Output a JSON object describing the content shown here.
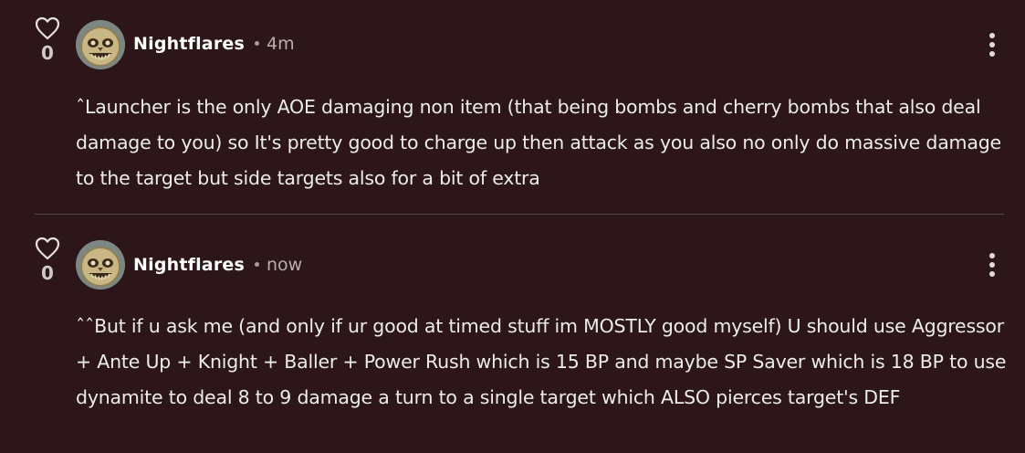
{
  "comments": [
    {
      "likes": "0",
      "author": "Nightflares",
      "time": "4m",
      "avatar_icon": "skull-moon-avatar-icon",
      "text": "ˆLauncher is the only AOE damaging non item (that being bombs and cherry bombs that also deal damage to you) so It's pretty good to charge up then attack as you also no only do massive damage to the target but side targets also for a bit of extra"
    },
    {
      "likes": "0",
      "author": "Nightflares",
      "time": "now",
      "avatar_icon": "skull-moon-avatar-icon",
      "text": "ˆˆBut if u ask me (and only if ur good at timed stuff im MOSTLY good myself) U should use Aggressor + Ante Up + Knight + Baller + Power Rush which is 15 BP and maybe SP Saver which is 18 BP to use dynamite to deal 8 to 9 damage a turn to a single target which ALSO pierces target's DEF"
    }
  ],
  "colors": {
    "background": "#2d1619",
    "text": "#ececec",
    "muted": "#b8aeae",
    "divider": "#5a4648"
  },
  "icons": {
    "like": "heart-outline-icon",
    "menu": "more-vertical-icon"
  }
}
